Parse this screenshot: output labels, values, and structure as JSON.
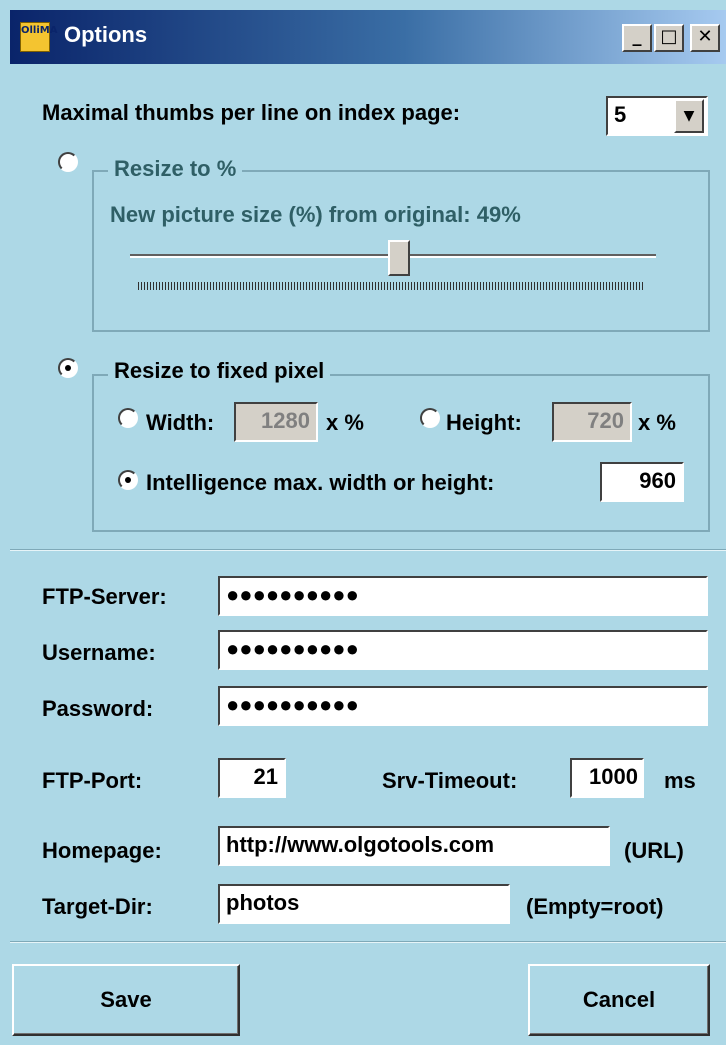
{
  "window": {
    "title": "Options",
    "icon_text": "OlliMA",
    "icon": "app-icon",
    "controls": {
      "minimize": "_",
      "maximize": "□",
      "close": "✕"
    }
  },
  "thumbs": {
    "label": "Maximal thumbs per line on index page:",
    "value": "5"
  },
  "resize_percent": {
    "title": "Resize to %",
    "selected": false,
    "label_prefix": "New picture size (%) from original:",
    "value_text": "49%",
    "value": 49
  },
  "resize_fixed": {
    "title": "Resize to fixed pixel",
    "selected": true,
    "width_label": "Width:",
    "width_value": "1280",
    "width_unit": "x %",
    "height_label": "Height:",
    "height_value": "720",
    "height_unit": "x %",
    "intelligence_label": "Intelligence max. width or height:",
    "intelligence_value": "960"
  },
  "ftp": {
    "server_label": "FTP-Server:",
    "server_value": "●●●●●●●●●●",
    "username_label": "Username:",
    "username_value": "●●●●●●●●●●",
    "password_label": "Password:",
    "password_value": "●●●●●●●●●●",
    "port_label": "FTP-Port:",
    "port_value": "21",
    "timeout_label": "Srv-Timeout:",
    "timeout_value": "1000",
    "timeout_unit": "ms",
    "homepage_label": "Homepage:",
    "homepage_value": "http://www.olgotools.com",
    "homepage_hint": "(URL)",
    "target_label": "Target-Dir:",
    "target_value": "photos",
    "target_hint": "(Empty=root)"
  },
  "buttons": {
    "save": "Save",
    "cancel": "Cancel"
  },
  "colors": {
    "background": "#add8e6",
    "titlebar": "#0a246a"
  }
}
